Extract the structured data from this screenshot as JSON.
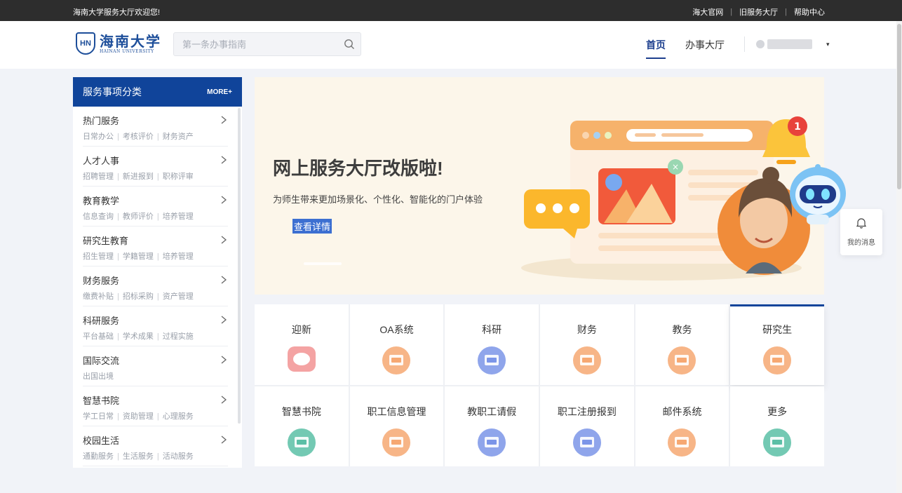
{
  "topbar": {
    "welcome": "海南大学服务大厅欢迎您!",
    "links": [
      "海大官网",
      "旧服务大厅",
      "帮助中心"
    ],
    "separator": "|"
  },
  "logo": {
    "cn": "海南大学",
    "en": "HAINAN UNIVERSITY",
    "mark": "HN"
  },
  "search": {
    "placeholder": "第一条办事指南",
    "icon": "search-icon"
  },
  "nav": {
    "home": "首页",
    "hall": "办事大厅"
  },
  "user": {
    "caret": "▾"
  },
  "sidebar": {
    "title": "服务事项分类",
    "more": "MORE+",
    "categories": [
      {
        "name": "热门服务",
        "subs": [
          "日常办公",
          "考核评价",
          "财务资产"
        ]
      },
      {
        "name": "人才人事",
        "subs": [
          "招聘管理",
          "新进报到",
          "职称评审"
        ]
      },
      {
        "name": "教育教学",
        "subs": [
          "信息查询",
          "教师评价",
          "培养管理"
        ]
      },
      {
        "name": "研究生教育",
        "subs": [
          "招生管理",
          "学籍管理",
          "培养管理"
        ]
      },
      {
        "name": "财务服务",
        "subs": [
          "缴费补贴",
          "招标采购",
          "资产管理"
        ]
      },
      {
        "name": "科研服务",
        "subs": [
          "平台基础",
          "学术成果",
          "过程实施"
        ]
      },
      {
        "name": "国际交流",
        "subs": [
          "出国出境"
        ]
      },
      {
        "name": "智慧书院",
        "subs": [
          "学工日常",
          "资助管理",
          "心理服务"
        ]
      },
      {
        "name": "校园生活",
        "subs": [
          "通勤服务",
          "生活服务",
          "活动服务"
        ]
      }
    ]
  },
  "banner": {
    "headline": "网上服务大厅改版啦!",
    "subtitle": "为师生带来更加场景化、个性化、智能化的门户体验",
    "cta": "查看详情",
    "badge": "1"
  },
  "tiles": [
    {
      "label": "迎新",
      "icon": "hi-icon",
      "color": "#f4a3a3"
    },
    {
      "label": "OA系统",
      "icon": "oa-icon",
      "color": "#f6a872"
    },
    {
      "label": "科研",
      "icon": "research-icon",
      "color": "#7b95e8"
    },
    {
      "label": "财务",
      "icon": "finance-icon",
      "color": "#f6a872"
    },
    {
      "label": "教务",
      "icon": "academic-icon",
      "color": "#f6a872"
    },
    {
      "label": "研究生",
      "icon": "graduate-icon",
      "color": "#f6a872"
    },
    {
      "label": "智慧书院",
      "icon": "academy-icon",
      "color": "#5bbfa6"
    },
    {
      "label": "职工信息管理",
      "icon": "staff-info-icon",
      "color": "#f6a872"
    },
    {
      "label": "教职工请假",
      "icon": "leave-icon",
      "color": "#7b95e8"
    },
    {
      "label": "职工注册报到",
      "icon": "register-icon",
      "color": "#7b95e8"
    },
    {
      "label": "邮件系统",
      "icon": "mail-icon",
      "color": "#f6a872"
    },
    {
      "label": "更多",
      "icon": "more-icon",
      "color": "#5bbfa6"
    }
  ],
  "messages": {
    "label": "我的消息"
  },
  "colors": {
    "primary": "#10449a",
    "topbar": "#2d2d2d",
    "banner_bg": "#fcf6ea"
  }
}
